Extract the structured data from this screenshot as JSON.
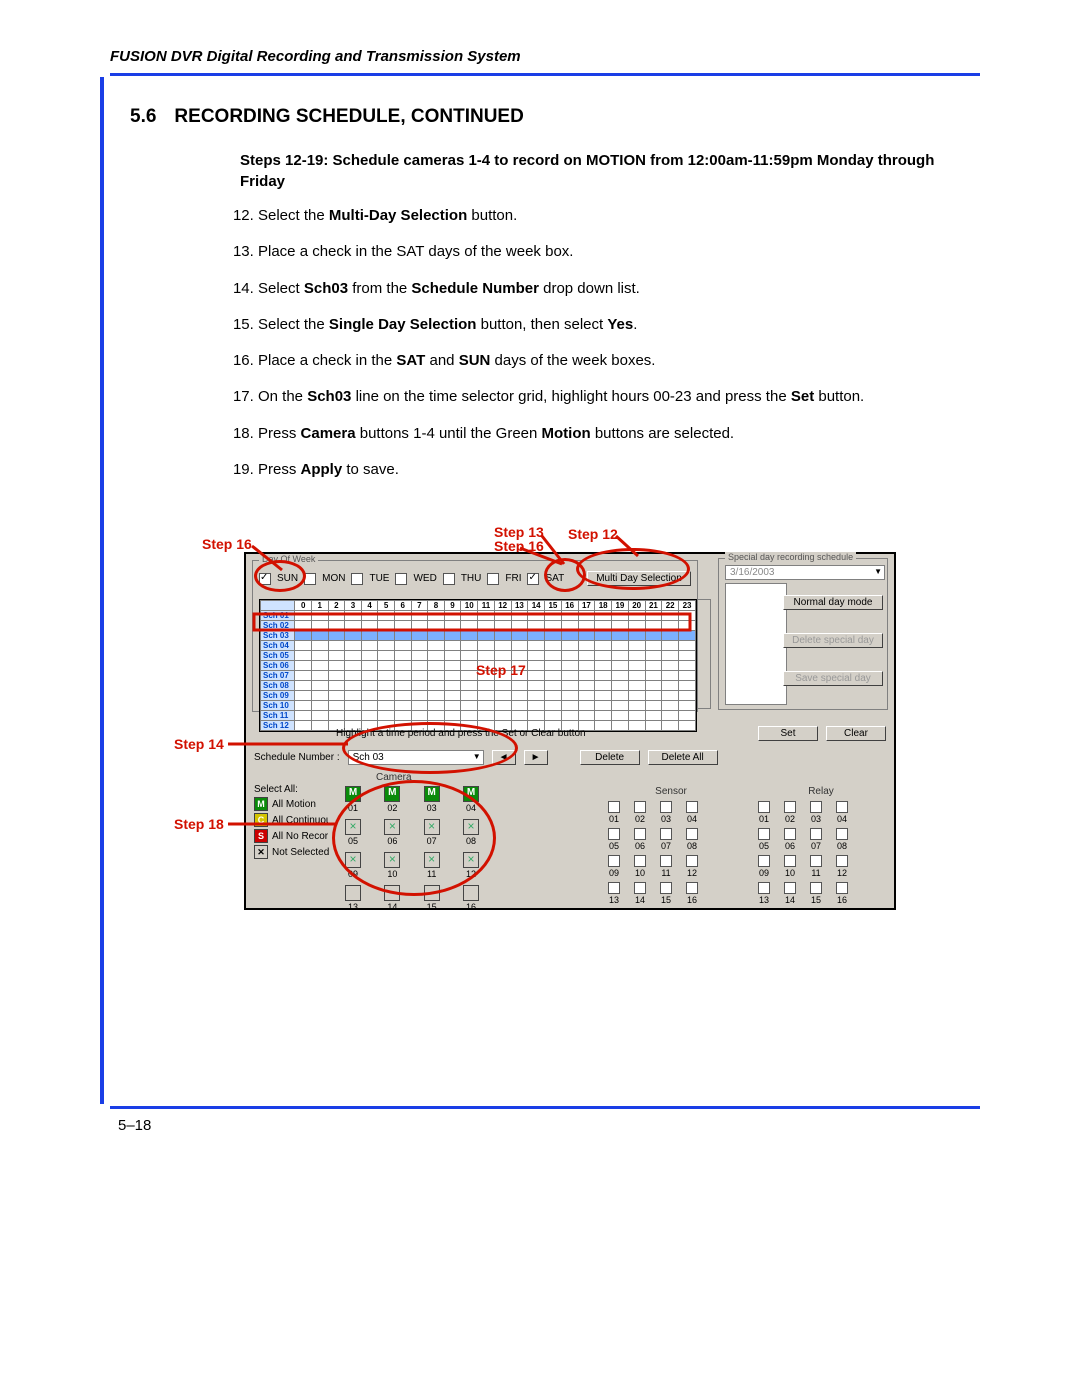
{
  "doc": {
    "header": "FUSION DVR Digital Recording and Transmission System",
    "section_no": "5.6",
    "section_title": "RECORDING SCHEDULE, CONTINUED",
    "subheading": "Steps 12-19: Schedule cameras 1-4 to record on MOTION from 12:00am-11:59pm Monday through Friday",
    "page_no": "5–18"
  },
  "steps": {
    "start": 12,
    "items": [
      "Select the <b>Multi-Day Selection</b> button.",
      "Place a check in the SAT days of the week box.",
      "Select <b>Sch03</b> from the <b>Schedule Number</b> drop down list.",
      "Select the <b>Single Day Selection</b> button, then select <b>Yes</b>.",
      "Place a check in the <b>SAT</b> and <b>SUN</b> days of the week boxes.",
      "On the <b>Sch03</b> line on the time selector grid, highlight hours 00-23 and press the <b>Set</b> button.",
      "Press <b>Camera</b> buttons 1-4 until the Green <b>Motion</b> buttons are selected.",
      "Press <b>Apply</b> to save."
    ]
  },
  "callouts": {
    "s12": "Step 12",
    "s13": "Step 13",
    "s14": "Step 14",
    "s16a": "Step 16",
    "s16b": "Step 16",
    "s17": "Step 17",
    "s18": "Step 18"
  },
  "ui": {
    "day_of_week_title": "Day Of Week",
    "days": [
      "SUN",
      "MON",
      "TUE",
      "WED",
      "THU",
      "FRI",
      "SAT"
    ],
    "days_checked": {
      "SUN": true,
      "SAT": true
    },
    "multi_day_btn": "Multi Day Selection",
    "special_title": "Special day recording schedule",
    "special_date": "3/16/2003",
    "special_btns": [
      "Normal day mode",
      "Delete special day",
      "Save special day"
    ],
    "sch_rows": [
      "Sch 01",
      "Sch 02",
      "Sch 03",
      "Sch 04",
      "Sch 05",
      "Sch 06",
      "Sch 07",
      "Sch 08",
      "Sch 09",
      "Sch 10",
      "Sch 11",
      "Sch 12"
    ],
    "hint": "Highlight a time period and press the Set or Clear button",
    "set_btn": "Set",
    "clear_btn": "Clear",
    "sched_no_label": "Schedule Number :",
    "sched_no_value": "Sch 03",
    "delete_btn": "Delete",
    "delete_all_btn": "Delete All",
    "select_all_label": "Select All:",
    "camera_label": "Camera",
    "sensor_label": "Sensor",
    "relay_label": "Relay",
    "keys": {
      "motion": "All Motion",
      "cont": "All Continuous",
      "norec": "All No Record",
      "nosel": "Not Selected"
    },
    "cam_nums": [
      "01",
      "02",
      "03",
      "04",
      "05",
      "06",
      "07",
      "08",
      "09",
      "10",
      "11",
      "12",
      "13",
      "14",
      "15",
      "16"
    ],
    "sr_nums": [
      "01",
      "02",
      "03",
      "04",
      "05",
      "06",
      "07",
      "08",
      "09",
      "10",
      "11",
      "12",
      "13",
      "14",
      "15",
      "16"
    ]
  }
}
